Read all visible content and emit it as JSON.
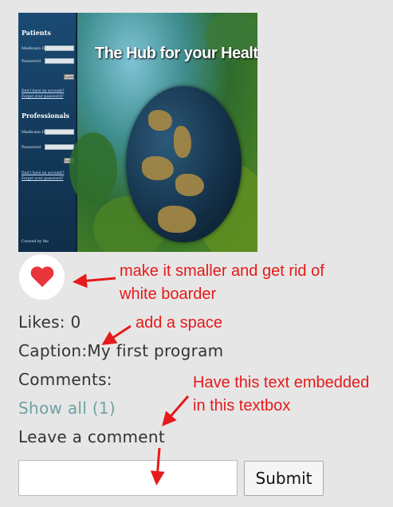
{
  "post": {
    "image": {
      "title": "The Hub for your Health",
      "sidebar": {
        "patients_heading": "Patients",
        "medicare_label": "Medicare ID",
        "password_label": "Password",
        "submit_label": "Submit",
        "no_account_link": "Don't have an account?",
        "forgot_link": "Forgot your password?",
        "professionals_heading": "Professionals",
        "footer": "Created by the"
      }
    },
    "likes_text": "Likes: 0",
    "caption_text": "Caption:My first program",
    "comments_label": "Comments:",
    "show_all_link": "Show all (1)",
    "leave_comment_label": "Leave a comment",
    "comment_input_value": "",
    "submit_label": "Submit"
  },
  "annotations": {
    "heart_note_line1": "make it smaller and get rid of",
    "heart_note_line2": "white boarder",
    "caption_note": "add a space",
    "textbox_note_line1": "Have this text embedded",
    "textbox_note_line2": "in this textbox",
    "color": "#e51a1a"
  },
  "colors": {
    "background": "#e6e6e6",
    "heart": "#e8363d",
    "link": "#6fa3a3"
  }
}
